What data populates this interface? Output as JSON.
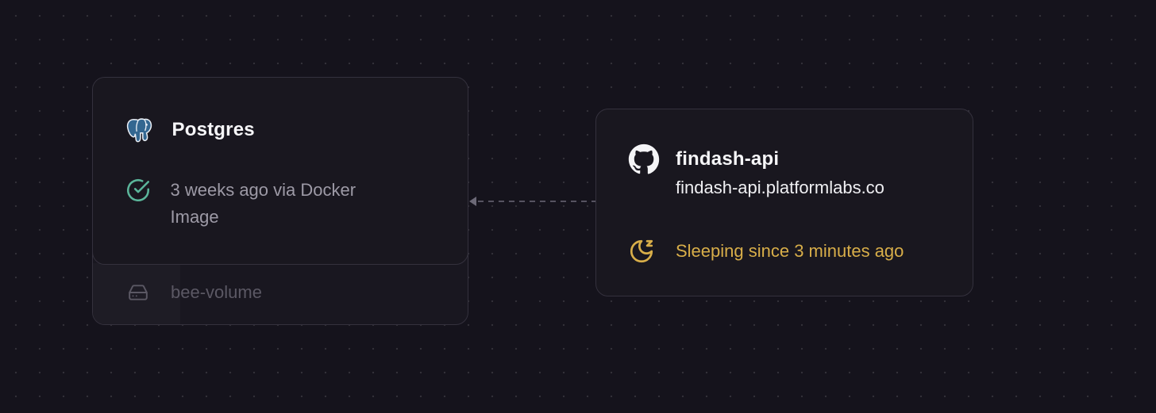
{
  "canvas": {
    "background": "#15131c",
    "dot_color": "#ffffff"
  },
  "postgres": {
    "icon": "postgres-elephant-icon",
    "title": "Postgres",
    "status_icon": "check-circle-icon",
    "status_line1": "3 weeks ago via Docker",
    "status_line2": "Image",
    "status_color": "#5bb59a",
    "volume": {
      "icon": "hard-drive-icon",
      "label": "bee-volume"
    }
  },
  "api": {
    "icon": "github-icon",
    "title": "findash-api",
    "domain": "findash-api.platformlabs.co",
    "status_icon": "moon-sleep-icon",
    "status": "Sleeping since 3 minutes ago",
    "status_color": "#d8ae49"
  }
}
